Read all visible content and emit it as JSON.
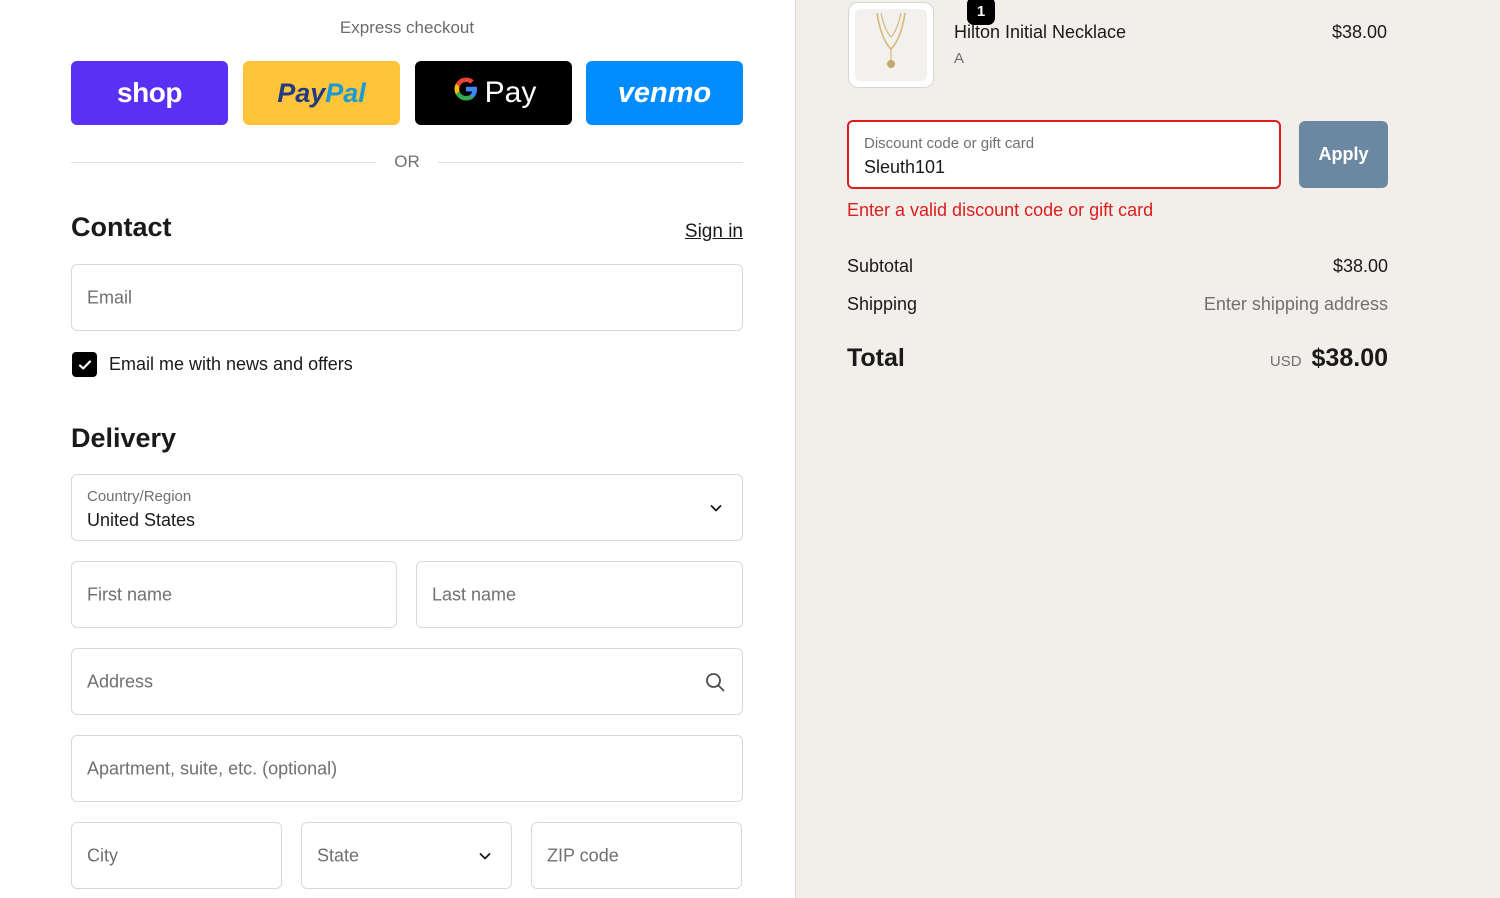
{
  "express": {
    "title": "Express checkout",
    "shop_label": "shop",
    "paypal_part1": "Pay",
    "paypal_part2": "Pal",
    "gpay_g": "G",
    "gpay_label": "Pay",
    "venmo_label": "venmo",
    "or_text": "OR"
  },
  "contact": {
    "title": "Contact",
    "sign_in": "Sign in",
    "email_placeholder": "Email",
    "newsletter_label": "Email me with news and offers",
    "newsletter_checked": true
  },
  "delivery": {
    "title": "Delivery",
    "country_label": "Country/Region",
    "country_value": "United States",
    "first_name_placeholder": "First name",
    "last_name_placeholder": "Last name",
    "address_placeholder": "Address",
    "apartment_placeholder": "Apartment, suite, etc. (optional)",
    "city_placeholder": "City",
    "state_placeholder": "State",
    "zip_placeholder": "ZIP code"
  },
  "order": {
    "product": {
      "name": "Hilton Initial Necklace",
      "variant": "A",
      "price": "$38.00",
      "quantity": "1"
    },
    "discount": {
      "label": "Discount code or gift card",
      "value": "Sleuth101",
      "apply_label": "Apply",
      "error": "Enter a valid discount code or gift card"
    },
    "subtotal_label": "Subtotal",
    "subtotal_value": "$38.00",
    "shipping_label": "Shipping",
    "shipping_value": "Enter shipping address",
    "total_label": "Total",
    "currency": "USD",
    "total_value": "$38.00"
  },
  "colors": {
    "shop": "#5a31f4",
    "paypal": "#ffc439",
    "gpay": "#000000",
    "venmo": "#008cff",
    "error": "#dd1d1d",
    "apply": "#6b88a2"
  }
}
